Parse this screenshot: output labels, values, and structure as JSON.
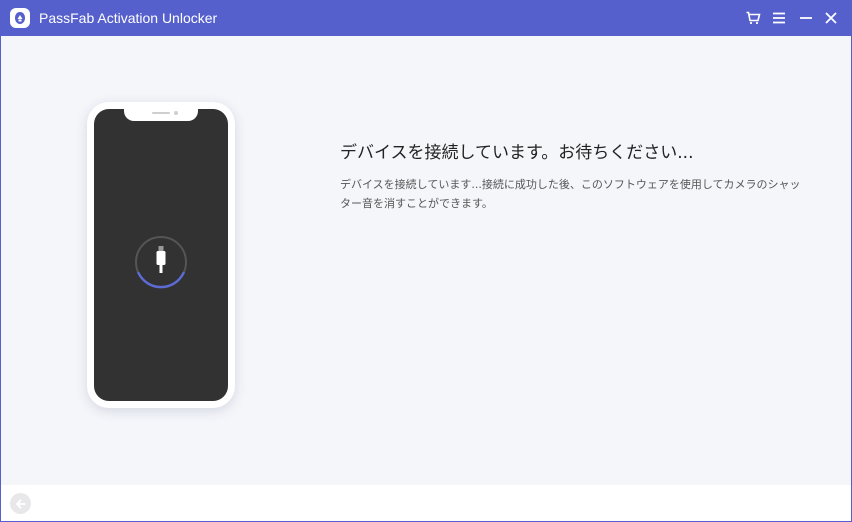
{
  "window": {
    "title": "PassFab Activation Unlocker",
    "accent_color": "#5560cc",
    "controls": [
      "cart-icon",
      "menu-icon",
      "minimize-icon",
      "close-icon"
    ]
  },
  "main": {
    "heading": "デバイスを接続しています。お待ちください...",
    "description": "デバイスを接続しています...接続に成功した後、このソフトウェアを使用してカメラのシャッター音を消すことができます。",
    "illustration": {
      "device": "iphone",
      "icon": "lightning-cable-icon",
      "spinner": "loading"
    }
  },
  "footer": {
    "back_icon": "back-arrow-icon"
  }
}
